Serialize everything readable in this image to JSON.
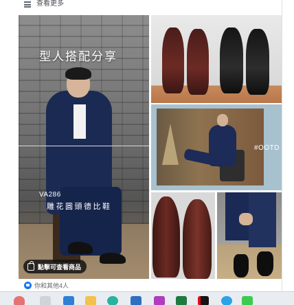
{
  "post": {
    "see_more_label": "查看更多",
    "reactions_text": "你和其他4人"
  },
  "photos": {
    "main_heading": "型人搭配分享",
    "model_code": "VA286",
    "model_subtitle": "雕花圓頭德比鞋",
    "shop_button_label": "點擊可查看商品",
    "ootd_tag": "#OOTD"
  },
  "taskbar": {
    "apps": [
      "photos-app",
      "file-explorer",
      "edge-browser",
      "folder",
      "browser-2",
      "store",
      "instagram",
      "excel",
      "netflix",
      "skype",
      "line"
    ]
  },
  "colors": {
    "like_blue": "#1877f2",
    "suit_navy": "#1b2a52",
    "shoe_brown": "#6d2a24"
  }
}
